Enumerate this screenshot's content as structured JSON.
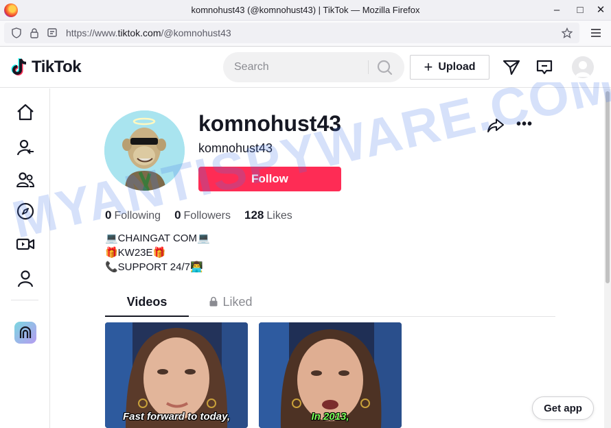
{
  "window": {
    "title": "komnohust43 (@komnohust43) | TikTok — Mozilla Firefox",
    "url_prefix": "https://www.",
    "url_domain": "tiktok.com",
    "url_path": "/@komnohust43"
  },
  "header": {
    "logo": "TikTok",
    "search_placeholder": "Search",
    "upload_label": "Upload"
  },
  "profile": {
    "username": "komnohust43",
    "nickname": "komnohust43",
    "follow_label": "Follow",
    "stats": [
      {
        "value": "0",
        "label": "Following"
      },
      {
        "value": "0",
        "label": "Followers"
      },
      {
        "value": "128",
        "label": "Likes"
      }
    ],
    "bio": [
      "💻CHAINGAT COM💻",
      "🎁KW23E🎁",
      "📞SUPPORT 24/7👨‍💻"
    ]
  },
  "tabs": {
    "videos": "Videos",
    "liked": "Liked"
  },
  "videos": [
    {
      "caption": "Fast forward to today,"
    },
    {
      "caption": "In 2013,"
    }
  ],
  "get_app": "Get app",
  "watermark": "MYANTISPYWARE.COM",
  "colors": {
    "brand": "#fe2c55",
    "text": "#161823"
  }
}
